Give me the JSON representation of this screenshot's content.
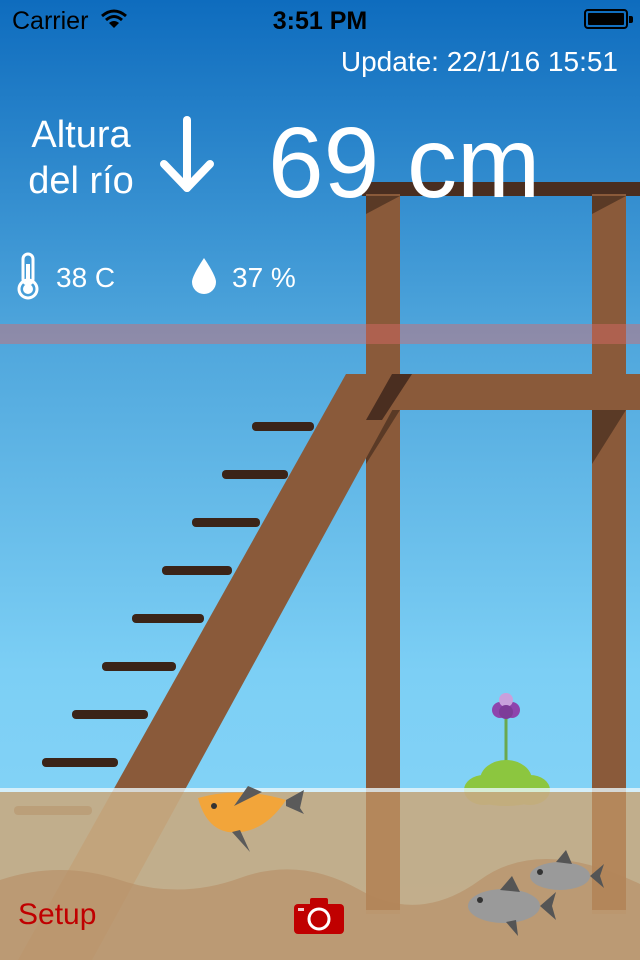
{
  "status_bar": {
    "carrier": "Carrier",
    "time": "3:51 PM",
    "wifi_icon": "wifi-icon",
    "battery_icon": "battery-icon"
  },
  "update": "Update: 22/1/16 15:51",
  "river_height": {
    "label_line1": "Altura",
    "label_line2": "del río",
    "trend_icon": "arrow-down-icon",
    "value": "69 cm"
  },
  "sensors": {
    "temperature_icon": "thermometer-icon",
    "temperature": "38 C",
    "humidity_icon": "water-drop-icon",
    "humidity": "37 %"
  },
  "toolbar": {
    "setup_label": "Setup",
    "camera_icon": "camera-icon"
  },
  "colors": {
    "sky_top": "#0f6fc0",
    "sky_bottom": "#7fd0f6",
    "wood": "#8a5a3a",
    "wood_dark": "#4a2e20",
    "sand": "#c4a67e",
    "accent_red": "#c00000"
  }
}
